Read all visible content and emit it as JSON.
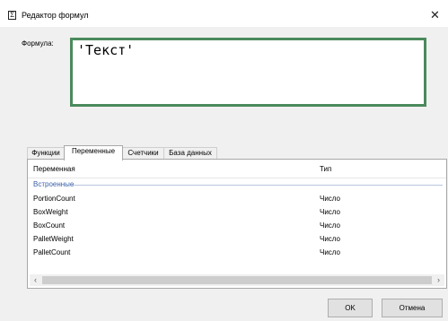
{
  "window": {
    "title": "Редактор формул",
    "app_icon_glyph": "Σ",
    "close_glyph": "✕"
  },
  "formula": {
    "label": "Формула:",
    "value": "'Текст'"
  },
  "tabs": [
    {
      "label": "Функции",
      "active": false
    },
    {
      "label": "Переменные",
      "active": true
    },
    {
      "label": "Счетчики",
      "active": false
    },
    {
      "label": "База данных",
      "active": false
    }
  ],
  "variables": {
    "columns": {
      "name": "Переменная",
      "type": "Тип"
    },
    "group": "Встроенные",
    "rows": [
      {
        "name": "PortionCount",
        "type": "Число"
      },
      {
        "name": "BoxWeight",
        "type": "Число"
      },
      {
        "name": "BoxCount",
        "type": "Число"
      },
      {
        "name": "PalletWeight",
        "type": "Число"
      },
      {
        "name": "PalletCount",
        "type": "Число"
      }
    ]
  },
  "scrollbar": {
    "left_glyph": "‹",
    "right_glyph": "›"
  },
  "buttons": {
    "ok": "OK",
    "cancel": "Отмена"
  },
  "colors": {
    "formula_border": "#4b8a5c",
    "group_label": "#3a5fa8"
  },
  "icons": [
    "sigma-icon",
    "close-icon",
    "scroll-left-icon",
    "scroll-right-icon"
  ]
}
